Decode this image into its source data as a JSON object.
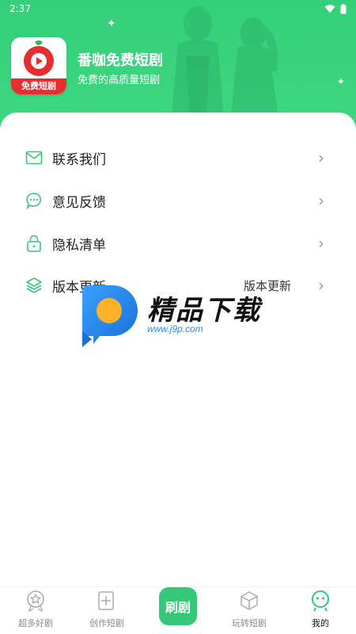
{
  "status_bar": {
    "time": "2:37"
  },
  "header": {
    "app_icon_caption": "免费短剧",
    "title": "番咖免费短剧",
    "subtitle": "免费的高质量短剧"
  },
  "menu": {
    "items": [
      {
        "label": "联系我们",
        "icon": "mail-icon"
      },
      {
        "label": "意见反馈",
        "icon": "chat-bubble-icon"
      },
      {
        "label": "隐私清单",
        "icon": "lock-icon"
      },
      {
        "label": "版本更新",
        "icon": "layers-icon",
        "value": "版本更新"
      }
    ]
  },
  "watermark": {
    "text": "精品下载",
    "url": "www.j9p.com"
  },
  "bottom_nav": {
    "items": [
      {
        "label": "超多好剧"
      },
      {
        "label": "创作短剧"
      },
      {
        "label": "刷剧"
      },
      {
        "label": "玩转短剧"
      },
      {
        "label": "我的"
      }
    ]
  },
  "colors": {
    "brand_green": "#35c977",
    "header_green": "#3fd882",
    "icon_green": "#35c977",
    "tomato_red": "#e52e2e"
  }
}
